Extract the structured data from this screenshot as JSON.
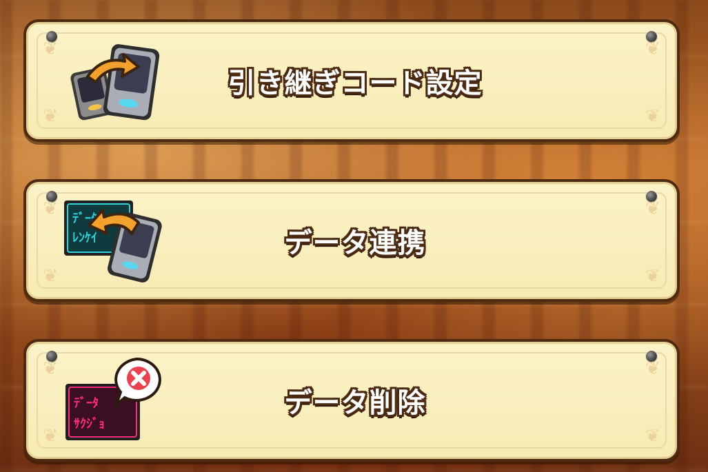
{
  "menu": {
    "items": [
      {
        "label": "引き継ぎコード設定",
        "icon": "transfer-code-icon"
      },
      {
        "label": "データ連携",
        "icon": "data-link-icon"
      },
      {
        "label": "データ削除",
        "icon": "data-delete-icon"
      }
    ]
  },
  "icon_glyphs": {
    "link_card_text_line1": "ﾃﾞｰﾀ",
    "link_card_text_line2": "ﾚﾝｹｲ",
    "delete_card_text_line1": "ﾃﾞｰﾀ",
    "delete_card_text_line2": "ｻｸｼﾞｮ"
  },
  "colors": {
    "card_bg": "#f7ebb4",
    "card_border": "#4e2a10",
    "label_outline": "#4a2a12",
    "arrow_orange": "#f2a12e",
    "link_cyan": "#2fd3dc",
    "delete_pink": "#ff2d7a",
    "delete_badge_red": "#e8424f"
  }
}
